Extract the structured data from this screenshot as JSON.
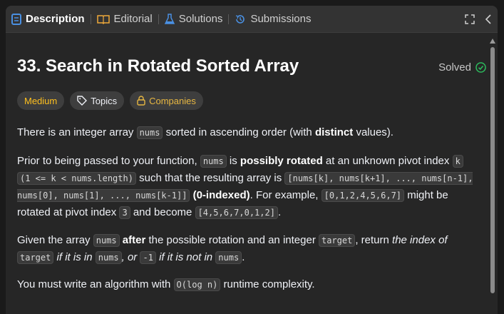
{
  "tabs": [
    {
      "label": "Description",
      "icon": "description-icon",
      "active": true
    },
    {
      "label": "Editorial",
      "icon": "book-icon",
      "active": false
    },
    {
      "label": "Solutions",
      "icon": "flask-icon",
      "active": false
    },
    {
      "label": "Submissions",
      "icon": "history-icon",
      "active": false
    }
  ],
  "problem": {
    "title": "33. Search in Rotated Sorted Array",
    "status": "Solved",
    "difficulty": "Medium",
    "topics_label": "Topics",
    "companies_label": "Companies"
  },
  "description": {
    "p1": [
      "There is an integer array ",
      "nums",
      " sorted in ascending order (with ",
      "distinct",
      " values)."
    ],
    "p2": [
      "Prior to being passed to your function, ",
      "nums",
      " is ",
      "possibly rotated",
      " at an unknown pivot index ",
      "k",
      " ",
      "(1 <= k < nums.length)",
      " such that the resulting array is ",
      "[nums[k], nums[k+1], ..., nums[n-1], nums[0], nums[1], ..., nums[k-1]]",
      " ",
      "(0-indexed)",
      ". For example, ",
      "[0,1,2,4,5,6,7]",
      " might be rotated at pivot index ",
      "3",
      " and become ",
      "[4,5,6,7,0,1,2]",
      "."
    ],
    "p3": [
      "Given the array ",
      "nums",
      " ",
      "after",
      " the possible rotation and an integer ",
      "target",
      ", return ",
      "the index of ",
      "target",
      " if it is in ",
      "nums",
      ", or ",
      "-1",
      " if it is not in ",
      "nums",
      "."
    ],
    "p4": [
      "You must write an algorithm with ",
      "O(log n)",
      " runtime complexity."
    ]
  },
  "colors": {
    "medium": "#ffc01e",
    "solved_check": "#2cbb5d",
    "companies": "#e7b742"
  }
}
